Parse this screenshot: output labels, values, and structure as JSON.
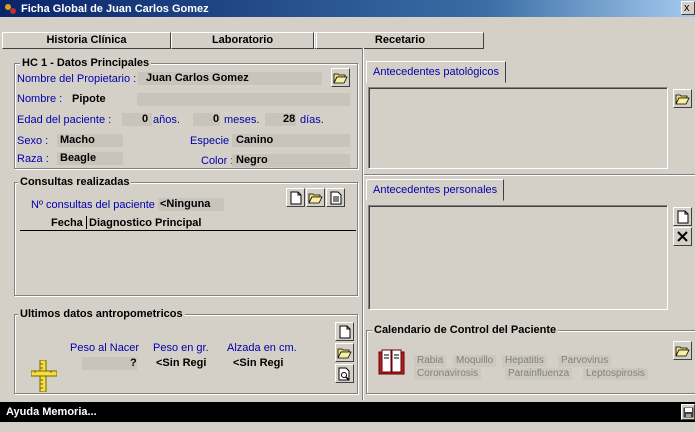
{
  "window": {
    "title": "Ficha Global de Juan Carlos Gomez",
    "close_glyph": "x"
  },
  "tabs": [
    {
      "label": "Historia Clínica"
    },
    {
      "label": "Laboratorio"
    },
    {
      "label": ""
    },
    {
      "label": "Recetario"
    }
  ],
  "datos": {
    "title": "HC 1 - Datos Principales",
    "propietario_label": "Nombre del Propietario :",
    "propietario_value": "Juan Carlos Gomez",
    "nombre_label": "Nombre :",
    "nombre_value": "Pipote",
    "edad_label": "Edad del paciente :",
    "edad_anios": "0",
    "anios_label": "años.",
    "edad_meses": "0",
    "meses_label": "meses.",
    "edad_dias": "28",
    "dias_label": "días.",
    "sexo_label": "Sexo :",
    "sexo_value": "Macho",
    "especie_label": "Especie :",
    "especie_value": "Canino",
    "raza_label": "Raza :",
    "raza_value": "Beagle",
    "color_label": "Color :",
    "color_value": "Negro"
  },
  "consultas": {
    "title": "Consultas realizadas",
    "count_label": "Nº consultas del paciente :",
    "count_value": "<Ninguna",
    "col_fecha": "Fecha",
    "col_diag": "Diagnostico Principal"
  },
  "antropo": {
    "title": "Ultimos datos antropometricos",
    "peso_nacer_label": "Peso al Nacer",
    "peso_nacer_value": "?",
    "peso_gr_label": "Peso en gr.",
    "peso_gr_value": "<Sin Regi",
    "alzada_label": "Alzada en cm.",
    "alzada_value": "<Sin Regi"
  },
  "patologicos": {
    "tab_label": "Antecedentes patológicos"
  },
  "personales": {
    "tab_label": "Antecedentes personales"
  },
  "calendario": {
    "title": "Calendario de Control del Paciente",
    "row1": [
      "Rabia",
      "Moquillo",
      "Hepatitis",
      "Parvovirus"
    ],
    "row2": [
      "Coronavirosis",
      "Parainfluenza",
      "Leptospirosis"
    ]
  },
  "status": {
    "text": "Ayuda Memoria..."
  }
}
